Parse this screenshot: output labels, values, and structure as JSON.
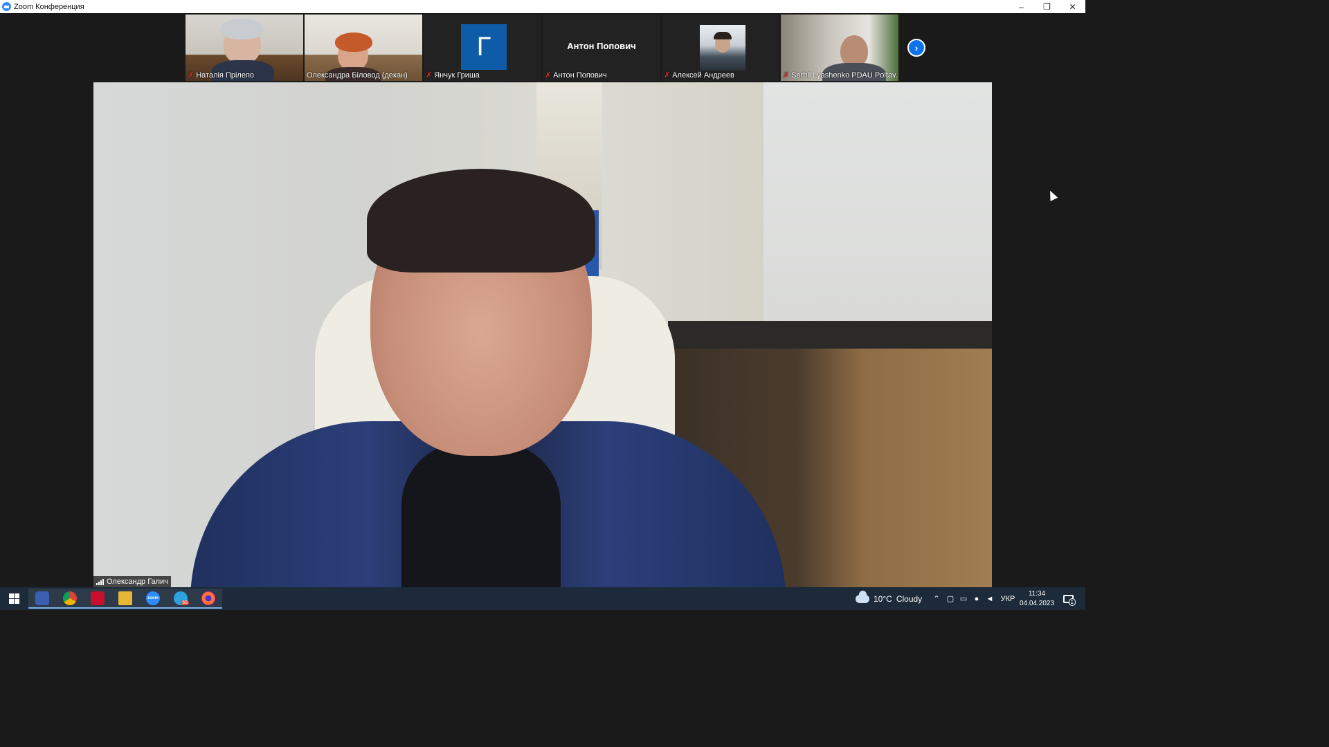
{
  "window": {
    "title": "Zoom Конференция",
    "controls": {
      "minimize": "–",
      "restore": "❐",
      "close": "✕"
    }
  },
  "gallery": {
    "participants": [
      {
        "name": "Наталія Прілепо",
        "muted": true,
        "type": "video"
      },
      {
        "name": "Олександра Біловод (декан)",
        "muted": false,
        "type": "video"
      },
      {
        "name": "Янчук Гриша",
        "muted": true,
        "type": "avatar",
        "avatar_letter": "Г"
      },
      {
        "name": "Антон Попович",
        "muted": true,
        "type": "name",
        "display_name": "Антон Попович"
      },
      {
        "name": "Алексей Андреев",
        "muted": true,
        "type": "photo"
      },
      {
        "name": "Serhii Lyashenko PDAU Poltav...",
        "muted": true,
        "type": "video"
      }
    ],
    "next_page_icon": "chevron-right-icon",
    "mute_icon": "✗"
  },
  "active_speaker": {
    "name": "Олександр Галич"
  },
  "taskbar": {
    "apps": [
      {
        "name": "start",
        "icon": "windows-logo-icon"
      },
      {
        "name": "save-app",
        "icon": "floppy-icon"
      },
      {
        "name": "chrome",
        "icon": "chrome-icon"
      },
      {
        "name": "acrobat",
        "icon": "pdf-icon"
      },
      {
        "name": "file-explorer",
        "icon": "folder-icon"
      },
      {
        "name": "zoom",
        "icon": "zoom-icon",
        "label": "zoom"
      },
      {
        "name": "telegram",
        "icon": "telegram-icon",
        "badge": "68"
      },
      {
        "name": "firefox",
        "icon": "firefox-icon"
      }
    ],
    "weather": {
      "temp": "10°C",
      "condition": "Cloudy"
    },
    "language": "УКР",
    "time": "11:34",
    "date": "04.04.2023",
    "notifications": "1"
  },
  "colors": {
    "zoom_blue": "#0e72ed",
    "mute_red": "#e0312b",
    "avatar_blue": "#0e5ba8",
    "taskbar": "#1c2a3a"
  }
}
